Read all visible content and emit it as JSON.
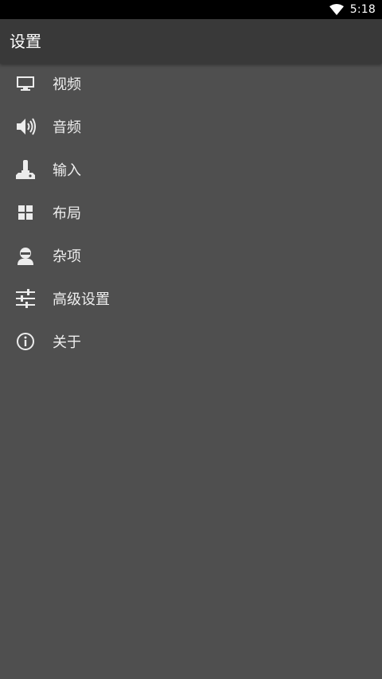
{
  "status_bar": {
    "time": "5:18",
    "icons": [
      "wifi-icon"
    ]
  },
  "header": {
    "title": "设置"
  },
  "menu": {
    "items": [
      {
        "label": "视频",
        "icon": "monitor-icon"
      },
      {
        "label": "音频",
        "icon": "speaker-icon"
      },
      {
        "label": "输入",
        "icon": "joystick-icon"
      },
      {
        "label": "布局",
        "icon": "grid-icon"
      },
      {
        "label": "杂项",
        "icon": "user-icon"
      },
      {
        "label": "高级设置",
        "icon": "sliders-icon"
      },
      {
        "label": "关于",
        "icon": "info-icon"
      }
    ]
  },
  "colors": {
    "background": "#4f4f4f",
    "app_bar": "#393939",
    "status_bar": "#000000",
    "text": "#eeeeee"
  }
}
